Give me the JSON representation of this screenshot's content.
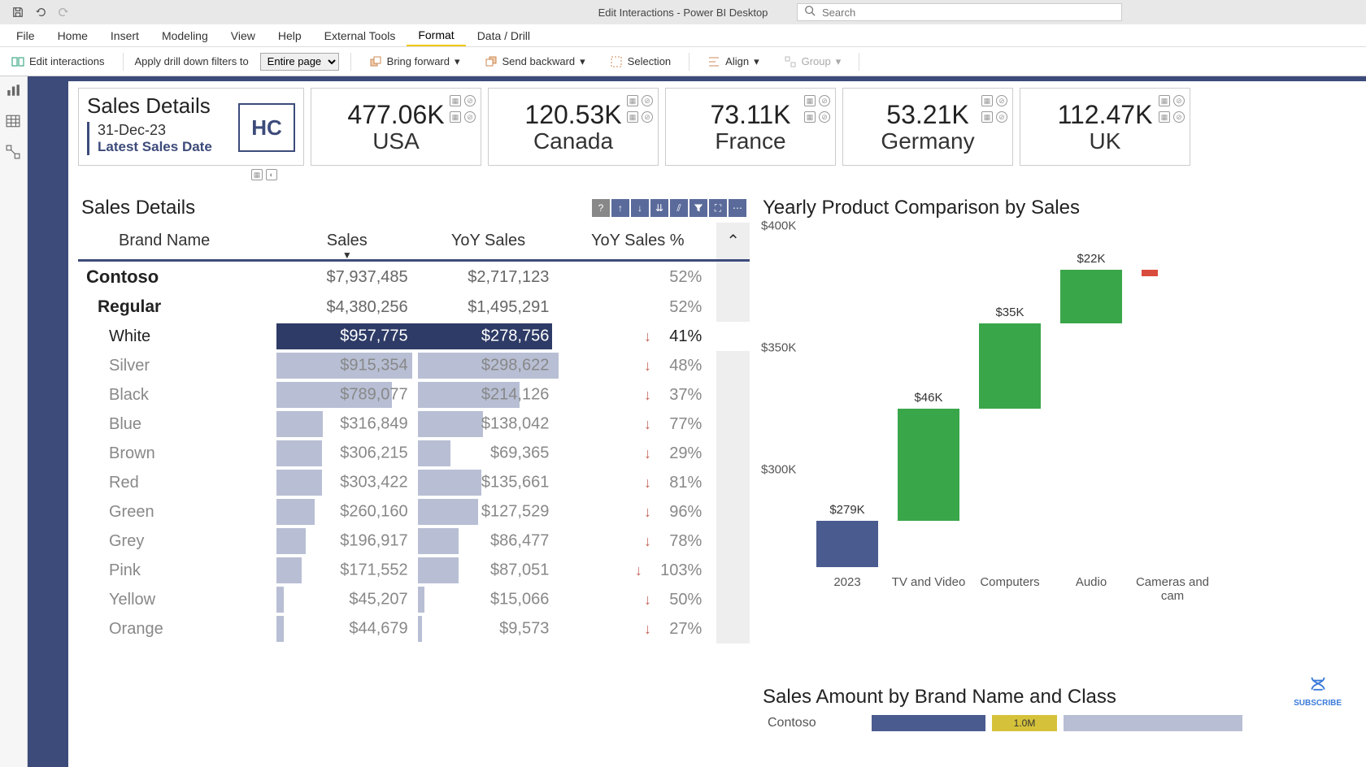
{
  "app": {
    "title": "Edit Interactions - Power BI Desktop",
    "search_placeholder": "Search"
  },
  "menus": [
    "File",
    "Home",
    "Insert",
    "Modeling",
    "View",
    "Help",
    "External Tools",
    "Format",
    "Data / Drill"
  ],
  "active_menu": "Format",
  "ribbon": {
    "edit_interactions": "Edit interactions",
    "apply_drill": "Apply drill down filters to",
    "drill_scope": "Entire page",
    "bring_forward": "Bring forward",
    "send_backward": "Send backward",
    "selection": "Selection",
    "align": "Align",
    "group": "Group"
  },
  "title_card": {
    "heading": "Sales Details",
    "date": "31-Dec-23",
    "latest": "Latest Sales Date",
    "logo": "HC"
  },
  "kpis": [
    {
      "value": "477.06K",
      "label": "USA"
    },
    {
      "value": "120.53K",
      "label": "Canada"
    },
    {
      "value": "73.11K",
      "label": "France"
    },
    {
      "value": "53.21K",
      "label": "Germany"
    },
    {
      "value": "112.47K",
      "label": "UK"
    }
  ],
  "table": {
    "title": "Sales Details",
    "cols": [
      "Brand Name",
      "Sales",
      "YoY Sales",
      "YoY Sales %"
    ],
    "rows": [
      {
        "lvl": 0,
        "name": "Contoso",
        "sales": "$7,937,485",
        "yoy": "$2,717,123",
        "pct": "52%",
        "w1": 100,
        "w2": 100
      },
      {
        "lvl": 1,
        "name": "Regular",
        "sales": "$4,380,256",
        "yoy": "$1,495,291",
        "pct": "52%",
        "w1": 100,
        "w2": 100
      },
      {
        "lvl": 2,
        "sel": true,
        "name": "White",
        "sales": "$957,775",
        "yoy": "$278,756",
        "pct": "41%",
        "arrow": true,
        "w1": 100,
        "w2": 95
      },
      {
        "lvl": 2,
        "name": "Silver",
        "sales": "$915,354",
        "yoy": "$298,622",
        "pct": "48%",
        "arrow": true,
        "w1": 96,
        "w2": 100
      },
      {
        "lvl": 2,
        "name": "Black",
        "sales": "$789,077",
        "yoy": "$214,126",
        "pct": "37%",
        "arrow": true,
        "w1": 82,
        "w2": 72
      },
      {
        "lvl": 2,
        "name": "Blue",
        "sales": "$316,849",
        "yoy": "$138,042",
        "pct": "77%",
        "arrow": true,
        "w1": 33,
        "w2": 46
      },
      {
        "lvl": 2,
        "name": "Brown",
        "sales": "$306,215",
        "yoy": "$69,365",
        "pct": "29%",
        "arrow": true,
        "w1": 32,
        "w2": 23
      },
      {
        "lvl": 2,
        "name": "Red",
        "sales": "$303,422",
        "yoy": "$135,661",
        "pct": "81%",
        "arrow": true,
        "w1": 32,
        "w2": 45
      },
      {
        "lvl": 2,
        "name": "Green",
        "sales": "$260,160",
        "yoy": "$127,529",
        "pct": "96%",
        "arrow": true,
        "w1": 27,
        "w2": 43
      },
      {
        "lvl": 2,
        "name": "Grey",
        "sales": "$196,917",
        "yoy": "$86,477",
        "pct": "78%",
        "arrow": true,
        "w1": 21,
        "w2": 29
      },
      {
        "lvl": 2,
        "name": "Pink",
        "sales": "$171,552",
        "yoy": "$87,051",
        "pct": "103%",
        "arrow": true,
        "w1": 18,
        "w2": 29
      },
      {
        "lvl": 2,
        "name": "Yellow",
        "sales": "$45,207",
        "yoy": "$15,066",
        "pct": "50%",
        "arrow": true,
        "w1": 5,
        "w2": 5
      },
      {
        "lvl": 2,
        "name": "Orange",
        "sales": "$44,679",
        "yoy": "$9,573",
        "pct": "27%",
        "arrow": true,
        "w1": 5,
        "w2": 3
      }
    ]
  },
  "chart_data": {
    "type": "bar",
    "title": "Yearly Product Comparison by Sales",
    "ylabel": "",
    "ylim": [
      260000,
      400000
    ],
    "yticks": [
      "$400K",
      "$350K",
      "$300K"
    ],
    "categories": [
      "2023",
      "TV and Video",
      "Computers",
      "Audio",
      "Cameras and cam"
    ],
    "series": [
      {
        "name": "delta",
        "values": [
          279000,
          46000,
          35000,
          22000,
          null
        ],
        "labels": [
          "$279K",
          "$46K",
          "$35K",
          "$22K",
          ""
        ],
        "colors": [
          "#4a5b8f",
          "#3aa64a",
          "#3aa64a",
          "#3aa64a",
          "#d94c3d"
        ]
      }
    ]
  },
  "bottom_chart": {
    "title": "Sales Amount by Brand Name and Class",
    "row_label": "Contoso",
    "seg_label": "1.0M"
  },
  "subscribe": "SUBSCRIBE"
}
